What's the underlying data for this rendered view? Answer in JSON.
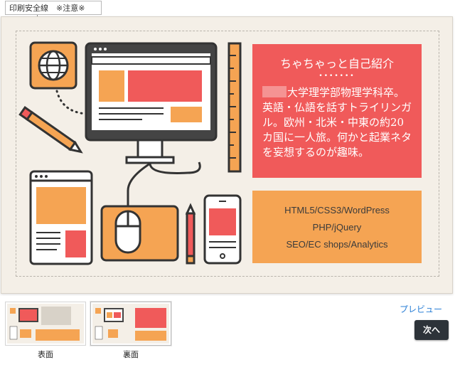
{
  "safety_line_label": "印刷安全線　※注意※",
  "card": {
    "intro": {
      "title": "ちゃちゃっと自己紹介",
      "dots": "•••••••",
      "body": "大学理学部物理学科卒。英語・仏語を話すトライリンガル。欧州・北米・中東の約20カ国に一人旅。何かと起業ネタを妄想するのが趣味。"
    },
    "skills": [
      "HTML5/CSS3/WordPress",
      "PHP/jQuery",
      "SEO/EC shops/Analytics"
    ]
  },
  "thumbnails": [
    {
      "label": "表面"
    },
    {
      "label": "裏面"
    }
  ],
  "actions": {
    "preview": "プレビュー",
    "next": "次へ"
  },
  "colors": {
    "card_bg": "#f4efe7",
    "red": "#f05a5a",
    "orange": "#f5a453",
    "outline": "#333333",
    "button": "#2d3339",
    "link": "#2a7fd6"
  }
}
